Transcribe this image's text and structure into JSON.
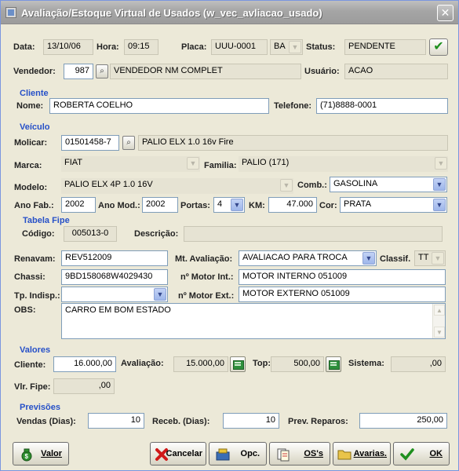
{
  "window": {
    "title": "Avaliação/Estoque Virtual de Usados (w_vec_avliacao_usado)",
    "close_glyph": "✕"
  },
  "header": {
    "data_label": "Data:",
    "data_value": "13/10/06",
    "hora_label": "Hora:",
    "hora_value": "09:15",
    "placa_label": "Placa:",
    "placa_value": "UUU-0001",
    "uf_value": "BA",
    "status_label": "Status:",
    "status_value": "PENDENTE",
    "vendedor_label": "Vendedor:",
    "vendedor_code": "987",
    "vendedor_name": "VENDEDOR NM COMPLET",
    "usuario_label": "Usuário:",
    "usuario_value": "ACAO"
  },
  "cliente": {
    "section": "Cliente",
    "nome_label": "Nome:",
    "nome_value": "ROBERTA COELHO",
    "telefone_label": "Telefone:",
    "telefone_value": "(71)8888-0001"
  },
  "veiculo": {
    "section": "Veículo",
    "molicar_label": "Molicar:",
    "molicar_code": "01501458-7",
    "molicar_desc": "PALIO ELX 1.0 16v Fire",
    "marca_label": "Marca:",
    "marca_value": "FIAT",
    "familia_label": "Familia:",
    "familia_value": "PALIO (171)",
    "modelo_label": "Modelo:",
    "modelo_value": "PALIO ELX 4P 1.0 16V",
    "comb_label": "Comb.:",
    "comb_value": "GASOLINA",
    "anofab_label": "Ano Fab.:",
    "anofab_value": "2002",
    "anomod_label": "Ano Mod.:",
    "anomod_value": "2002",
    "portas_label": "Portas:",
    "portas_value": "4",
    "km_label": "KM:",
    "km_value": "47.000",
    "cor_label": "Cor:",
    "cor_value": "PRATA"
  },
  "fipe": {
    "section": "Tabela Fipe",
    "codigo_label": "Código:",
    "codigo_value": "005013-0",
    "descricao_label": "Descrição:",
    "descricao_value": ""
  },
  "avaliacao": {
    "renavam_label": "Renavam:",
    "renavam_value": "REV512009",
    "mt_label": "Mt. Avaliação:",
    "mt_value": "AVALIACAO PARA TROCA",
    "classif_label": "Classif.",
    "classif_value": "TT",
    "chassi_label": "Chassi:",
    "chassi_value": "9BD158068W4029430",
    "motor_int_label": "nº Motor Int.:",
    "motor_int_value": "MOTOR INTERNO 051009",
    "tp_label": "Tp. Indisp.:",
    "tp_value": "",
    "motor_ext_label": "nº Motor Ext.:",
    "motor_ext_value": "MOTOR EXTERNO 051009",
    "obs_label": "OBS:",
    "obs_value": "CARRO EM BOM ESTADO"
  },
  "valores": {
    "section": "Valores",
    "cliente_label": "Cliente:",
    "cliente_value": "16.000,00",
    "avaliacao_label": "Avaliação:",
    "avaliacao_value": "15.000,00",
    "top_label": "Top:",
    "top_value": "500,00",
    "sistema_label": "Sistema:",
    "sistema_value": ",00",
    "fipe_label": "Vlr. Fipe:",
    "fipe_value": ",00"
  },
  "previsoes": {
    "section": "Previsões",
    "vendas_label": "Vendas (Dias):",
    "vendas_value": "10",
    "receb_label": "Receb. (Dias):",
    "receb_value": "10",
    "reparos_label": "Prev. Reparos:",
    "reparos_value": "250,00"
  },
  "buttons": {
    "valor": "Valor",
    "cancelar": "Cancelar",
    "opc": "Opc.",
    "os": "OS's",
    "avarias": "Avarias.",
    "ok": "OK"
  },
  "colors": {
    "section": "#2650c8",
    "accent_check": "#1e8f1e"
  }
}
